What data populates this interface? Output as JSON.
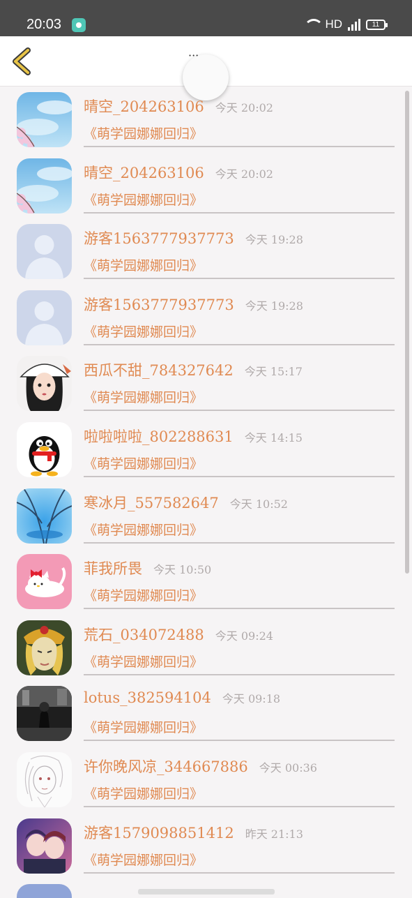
{
  "status_bar": {
    "time": "20:03",
    "network": "HD",
    "cell": "4G",
    "battery": "11"
  },
  "header": {
    "title": "··· ··"
  },
  "message_text": "《萌学园娜娜回归》",
  "rows": [
    {
      "name": "晴空_204263106",
      "time": "今天 20:02",
      "message": "《萌学园娜娜回归》",
      "avatar": "sky-cherry"
    },
    {
      "name": "晴空_204263106",
      "time": "今天 20:02",
      "message": "《萌学园娜娜回归》",
      "avatar": "sky-cherry"
    },
    {
      "name": "游客1563777937773",
      "time": "今天 19:28",
      "message": "《萌学园娜娜回归》",
      "avatar": "default-user"
    },
    {
      "name": "游客1563777937773",
      "time": "今天 19:28",
      "message": "《萌学园娜娜回归》",
      "avatar": "default-user"
    },
    {
      "name": "西瓜不甜_784327642",
      "time": "今天 15:17",
      "message": "《萌学园娜娜回归》",
      "avatar": "girl-hat"
    },
    {
      "name": "啦啦啦啦_802288631",
      "time": "今天 14:15",
      "message": "《萌学园娜娜回归》",
      "avatar": "qq-penguin"
    },
    {
      "name": "寒冰月_557582647",
      "time": "今天 10:52",
      "message": "《萌学园娜娜回归》",
      "avatar": "ice-tree"
    },
    {
      "name": "菲我所畏",
      "time": "今天 10:50",
      "message": "《萌学园娜娜回归》",
      "avatar": "hello-kitty"
    },
    {
      "name": "荒石_034072488",
      "time": "今天 09:24",
      "message": "《萌学园娜娜回归》",
      "avatar": "golden-warrior"
    },
    {
      "name": "lotus_382594104",
      "time": "今天 09:18",
      "message": "《萌学园娜娜回归》",
      "avatar": "dark-photo"
    },
    {
      "name": "许你晚风凉_344667886",
      "time": "今天 00:36",
      "message": "《萌学园娜娜回归》",
      "avatar": "sketch-girl"
    },
    {
      "name": "游客1579098851412",
      "time": "昨天 21:13",
      "message": "《萌学园娜娜回归》",
      "avatar": "anime-couple"
    }
  ],
  "colors": {
    "accent": "#e08a52",
    "time": "#b0aaaa",
    "status_bar": "#4a4a4a",
    "back_arrow": "#e8c447"
  }
}
